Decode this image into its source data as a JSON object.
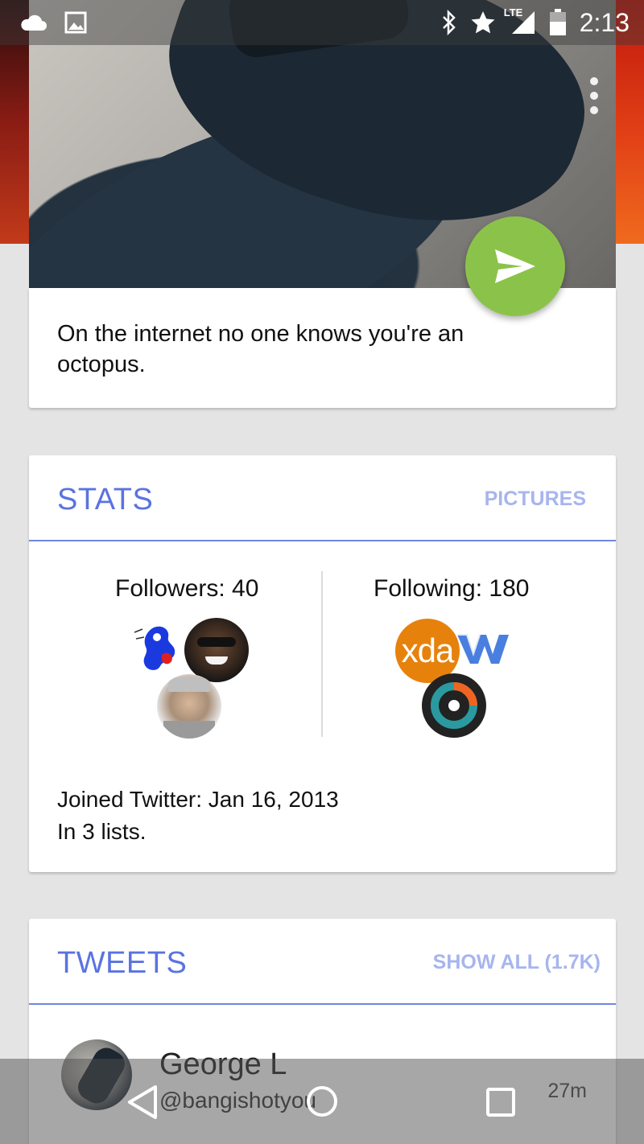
{
  "status_bar": {
    "time": "2:13",
    "network": "LTE",
    "icons": [
      "cloud-icon",
      "image-icon",
      "bluetooth-icon",
      "star-icon",
      "signal-icon",
      "battery-icon"
    ]
  },
  "profile": {
    "bio": "On the internet no one knows you're an octopus."
  },
  "stats": {
    "title": "STATS",
    "action": "PICTURES",
    "followers_label": "Followers: 40",
    "following_label": "Following: 180",
    "following_logos": {
      "xda": "xda"
    },
    "joined": "Joined Twitter: Jan 16, 2013",
    "lists": "In 3 lists."
  },
  "tweets": {
    "title": "TWEETS",
    "action": "SHOW ALL (1.7K)",
    "items": [
      {
        "name": "George L",
        "handle": "@bangishotyou",
        "time": "27m"
      }
    ]
  },
  "colors": {
    "accent": "#5a73e0",
    "fab": "#8bc34a",
    "action_text": "#a7b5ee"
  }
}
